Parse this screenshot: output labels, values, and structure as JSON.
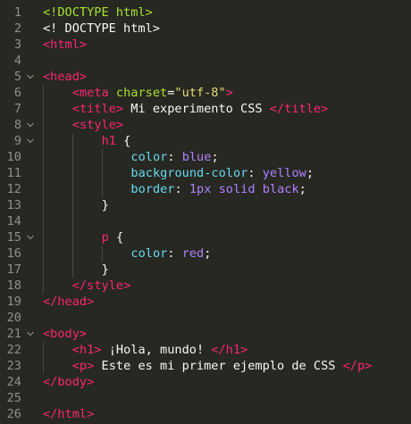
{
  "editor": {
    "lines": [
      {
        "num": "1",
        "tokens": [
          {
            "c": "t-doctype",
            "t": "<!DOCTYPE html>"
          }
        ]
      },
      {
        "num": "2",
        "tokens": [
          {
            "c": "t-txt",
            "t": "<! DOCTYPE html>"
          }
        ]
      },
      {
        "num": "3",
        "tokens": [
          {
            "c": "t-tag",
            "t": "<html>"
          }
        ]
      },
      {
        "num": "4",
        "tokens": []
      },
      {
        "num": "5",
        "fold": true,
        "tokens": [
          {
            "c": "t-tag",
            "t": "<head>"
          }
        ]
      },
      {
        "num": "6",
        "indent": 1,
        "tokens": [
          {
            "c": "t-tag",
            "t": "<meta "
          },
          {
            "c": "t-attr",
            "t": "charset"
          },
          {
            "c": "t-punct",
            "t": "="
          },
          {
            "c": "t-str",
            "t": "\"utf-8\""
          },
          {
            "c": "t-tag",
            "t": ">"
          }
        ]
      },
      {
        "num": "7",
        "indent": 1,
        "tokens": [
          {
            "c": "t-tag",
            "t": "<title>"
          },
          {
            "c": "t-txt",
            "t": " Mi experimento CSS "
          },
          {
            "c": "t-tag",
            "t": "</title>"
          }
        ]
      },
      {
        "num": "8",
        "indent": 1,
        "fold": true,
        "tokens": [
          {
            "c": "t-tag",
            "t": "<style>"
          }
        ]
      },
      {
        "num": "9",
        "indent": 2,
        "fold": true,
        "tokens": [
          {
            "c": "t-sel",
            "t": "h1"
          },
          {
            "c": "t-punct",
            "t": " {"
          }
        ]
      },
      {
        "num": "10",
        "indent": 3,
        "tokens": [
          {
            "c": "t-prop",
            "t": "color"
          },
          {
            "c": "t-punct",
            "t": ": "
          },
          {
            "c": "t-val",
            "t": "blue"
          },
          {
            "c": "t-punct",
            "t": ";"
          }
        ]
      },
      {
        "num": "11",
        "indent": 3,
        "tokens": [
          {
            "c": "t-prop",
            "t": "background-color"
          },
          {
            "c": "t-punct",
            "t": ": "
          },
          {
            "c": "t-val",
            "t": "yellow"
          },
          {
            "c": "t-punct",
            "t": ";"
          }
        ]
      },
      {
        "num": "12",
        "indent": 3,
        "tokens": [
          {
            "c": "t-prop",
            "t": "border"
          },
          {
            "c": "t-punct",
            "t": ": "
          },
          {
            "c": "t-val",
            "t": "1px"
          },
          {
            "c": "t-punct",
            "t": " "
          },
          {
            "c": "t-val",
            "t": "solid"
          },
          {
            "c": "t-punct",
            "t": " "
          },
          {
            "c": "t-val",
            "t": "black"
          },
          {
            "c": "t-punct",
            "t": ";"
          }
        ]
      },
      {
        "num": "13",
        "indent": 2,
        "tokens": [
          {
            "c": "t-punct",
            "t": "}"
          }
        ]
      },
      {
        "num": "14",
        "indent": 2,
        "tokens": []
      },
      {
        "num": "15",
        "indent": 2,
        "fold": true,
        "tokens": [
          {
            "c": "t-sel",
            "t": "p"
          },
          {
            "c": "t-punct",
            "t": " {"
          }
        ]
      },
      {
        "num": "16",
        "indent": 3,
        "tokens": [
          {
            "c": "t-prop",
            "t": "color"
          },
          {
            "c": "t-punct",
            "t": ": "
          },
          {
            "c": "t-val",
            "t": "red"
          },
          {
            "c": "t-punct",
            "t": ";"
          }
        ]
      },
      {
        "num": "17",
        "indent": 2,
        "tokens": [
          {
            "c": "t-punct",
            "t": "}"
          }
        ]
      },
      {
        "num": "18",
        "indent": 1,
        "tokens": [
          {
            "c": "t-tag",
            "t": "</style>"
          }
        ]
      },
      {
        "num": "19",
        "tokens": [
          {
            "c": "t-tag",
            "t": "</head>"
          }
        ]
      },
      {
        "num": "20",
        "tokens": []
      },
      {
        "num": "21",
        "fold": true,
        "tokens": [
          {
            "c": "t-tag",
            "t": "<body>"
          }
        ]
      },
      {
        "num": "22",
        "indent": 1,
        "tokens": [
          {
            "c": "t-tag",
            "t": "<h1>"
          },
          {
            "c": "t-txt",
            "t": " ¡Hola, mundo! "
          },
          {
            "c": "t-tag",
            "t": "</h1>"
          }
        ]
      },
      {
        "num": "23",
        "indent": 1,
        "tokens": [
          {
            "c": "t-tag",
            "t": "<p>"
          },
          {
            "c": "t-txt",
            "t": " Este es mi primer ejemplo de CSS "
          },
          {
            "c": "t-tag",
            "t": "</p>"
          }
        ]
      },
      {
        "num": "24",
        "tokens": [
          {
            "c": "t-tag",
            "t": "</body>"
          }
        ]
      },
      {
        "num": "25",
        "tokens": []
      },
      {
        "num": "26",
        "tokens": [
          {
            "c": "t-tag",
            "t": "</html>"
          }
        ]
      }
    ]
  }
}
